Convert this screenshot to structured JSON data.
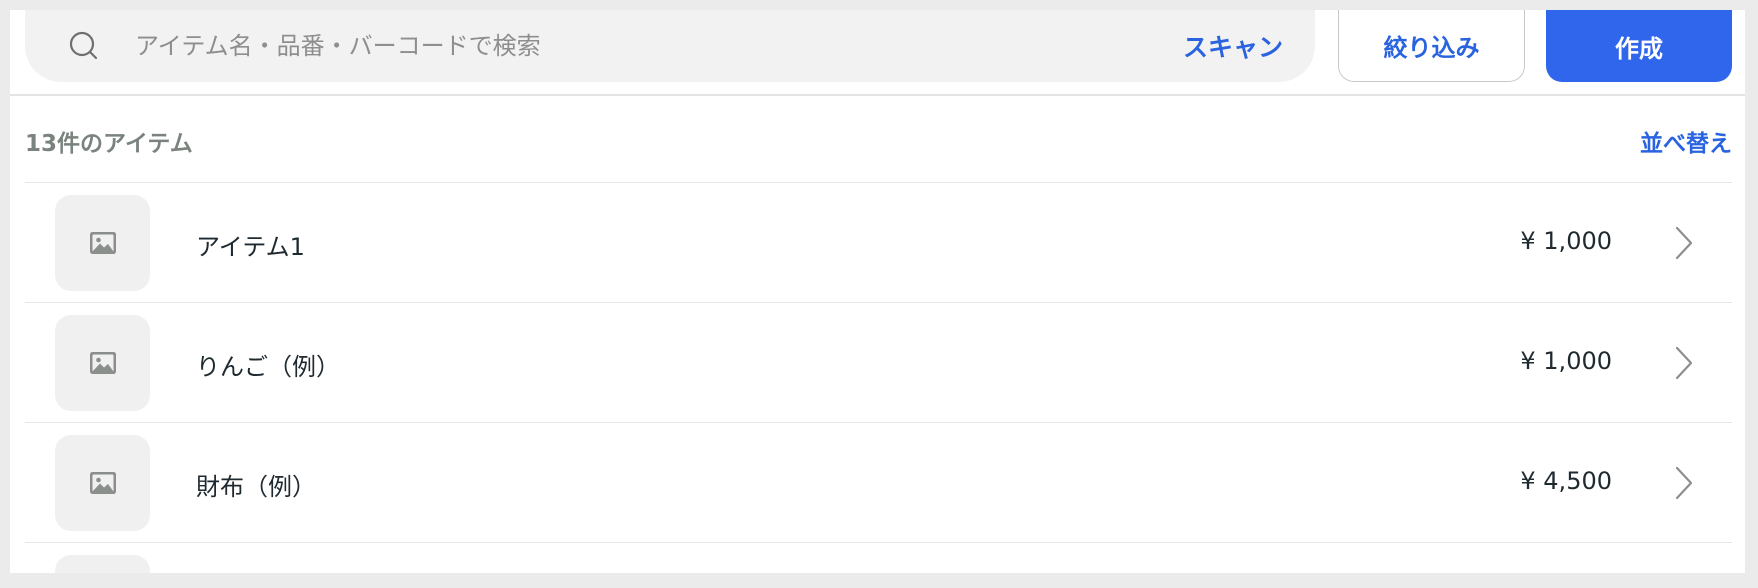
{
  "search": {
    "placeholder": "アイテム名・品番・バーコードで検索",
    "scan_label": "スキャン"
  },
  "toolbar": {
    "filter_label": "絞り込み",
    "create_label": "作成"
  },
  "list": {
    "count_label": "13件のアイテム",
    "sort_label": "並べ替え",
    "items": [
      {
        "name": "アイテム1",
        "price": "¥ 1,000",
        "thumbnail_icon": "image-placeholder-icon"
      },
      {
        "name": "りんご（例）",
        "price": "¥ 1,000",
        "thumbnail_icon": "image-placeholder-icon"
      },
      {
        "name": "財布（例）",
        "price": "¥ 4,500",
        "thumbnail_icon": "image-placeholder-icon"
      }
    ]
  },
  "colors": {
    "accent": "#3066ec",
    "link": "#2a63e0",
    "muted_text": "#7a837e",
    "body_text": "#1f2a30",
    "surface": "#f2f2f2"
  }
}
